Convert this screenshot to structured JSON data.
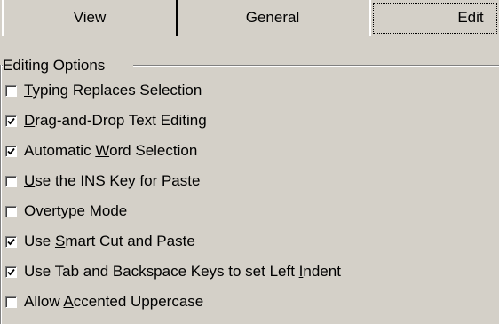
{
  "tabs": {
    "view": "View",
    "general": "General",
    "edit": "Edit"
  },
  "group": {
    "label": "Editing Options"
  },
  "options": [
    {
      "pre": "",
      "key": "T",
      "post": "yping Replaces Selection",
      "checked": false
    },
    {
      "pre": "",
      "key": "D",
      "post": "rag-and-Drop Text Editing",
      "checked": true
    },
    {
      "pre": "Automatic ",
      "key": "W",
      "post": "ord Selection",
      "checked": true
    },
    {
      "pre": "",
      "key": "U",
      "post": "se the INS Key for Paste",
      "checked": false
    },
    {
      "pre": "",
      "key": "O",
      "post": "vertype Mode",
      "checked": false
    },
    {
      "pre": "Use ",
      "key": "S",
      "post": "mart Cut and Paste",
      "checked": true
    },
    {
      "pre": "Use Tab and Backspace Keys to set Left ",
      "key": "I",
      "post": "ndent",
      "checked": true
    },
    {
      "pre": "Allow ",
      "key": "A",
      "post": "ccented Uppercase",
      "checked": false
    }
  ]
}
